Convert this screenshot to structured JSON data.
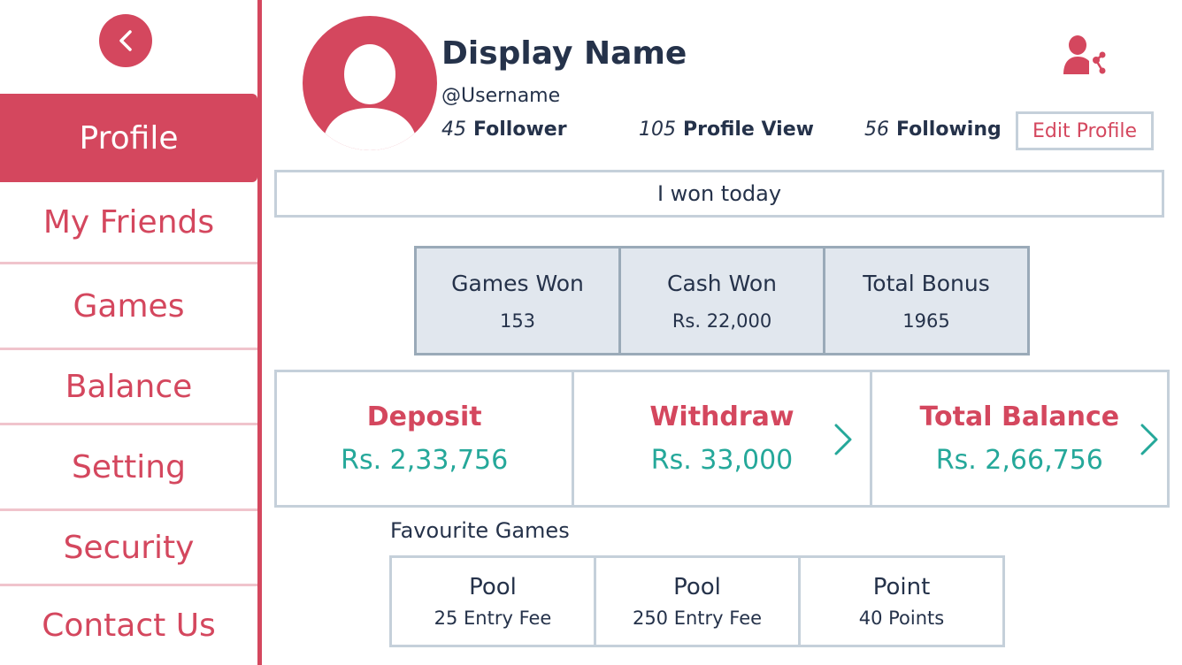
{
  "colors": {
    "accent": "#d4475e",
    "teal": "#25a89a",
    "text": "#25324a",
    "border": "#c5d0da",
    "stat_bg": "#e1e7ee"
  },
  "icons": {
    "back": "chevron-left-icon",
    "avatar": "user-silhouette-icon",
    "share": "user-share-icon",
    "arrow": "chevron-right-icon"
  },
  "sidebar": {
    "items": [
      {
        "label": "Profile",
        "active": true
      },
      {
        "label": "My Friends"
      },
      {
        "label": "Games"
      },
      {
        "label": "Balance"
      },
      {
        "label": "Setting"
      },
      {
        "label": "Security"
      },
      {
        "label": "Contact Us"
      }
    ]
  },
  "profile": {
    "display_name": "Display Name",
    "username": "@Username",
    "stats": [
      {
        "value": "45",
        "label": "Follower"
      },
      {
        "value": "105",
        "label": "Profile View"
      },
      {
        "value": "56",
        "label": "Following"
      }
    ],
    "edit_label": "Edit Profile",
    "status": "I won today"
  },
  "game_stats": [
    {
      "title": "Games Won",
      "value": "153"
    },
    {
      "title": "Cash Won",
      "value": "Rs. 22,000"
    },
    {
      "title": "Total Bonus",
      "value": "1965"
    }
  ],
  "balance": [
    {
      "title": "Deposit",
      "value": "Rs. 2,33,756"
    },
    {
      "title": "Withdraw",
      "value": "Rs. 33,000"
    },
    {
      "title": "Total Balance",
      "value": "Rs. 2,66,756"
    }
  ],
  "favourites": {
    "title": "Favourite Games",
    "items": [
      {
        "name": "Pool",
        "detail": "25 Entry Fee"
      },
      {
        "name": "Pool",
        "detail": "250 Entry Fee"
      },
      {
        "name": "Point",
        "detail": "40 Points"
      }
    ]
  }
}
